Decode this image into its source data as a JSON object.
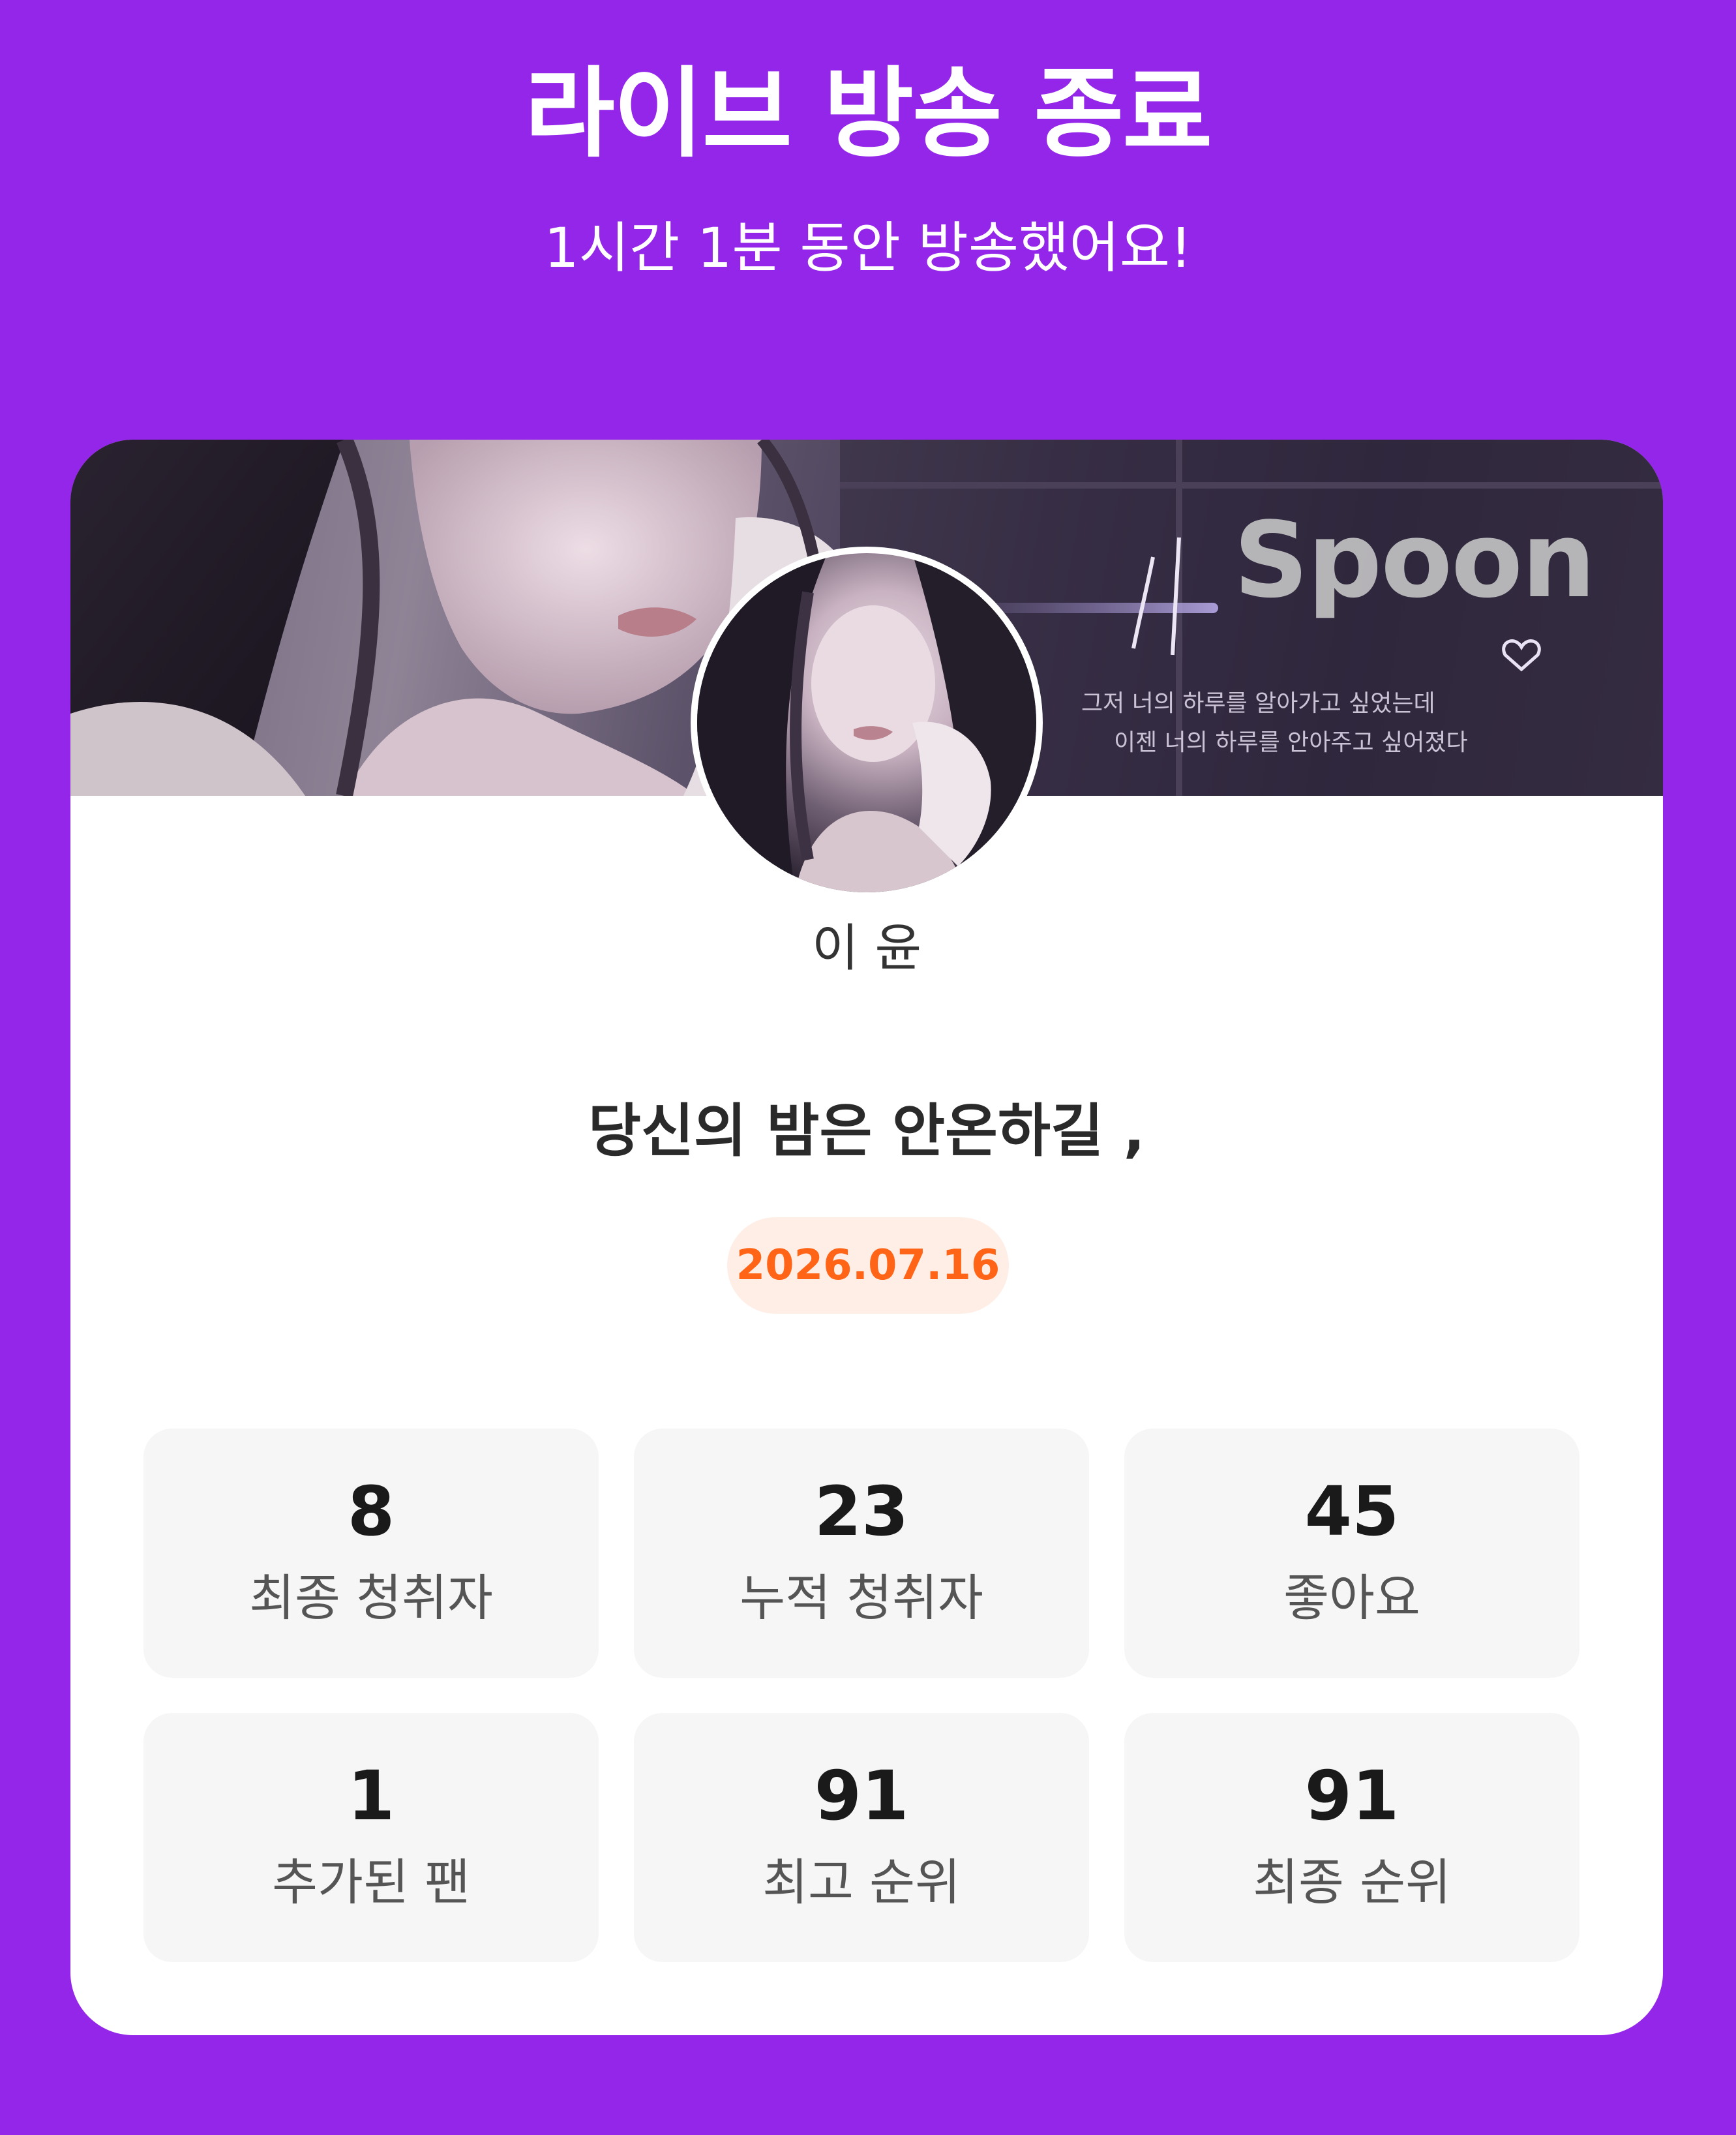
{
  "header": {
    "title": "라이브 방송 종료",
    "subtitle": "1시간 1분 동안 방송했어요!"
  },
  "banner": {
    "watermark": "Spoon",
    "line1": "그저 너의 하루를 알아가고 싶었는데",
    "line2": "이젠 너의 하루를 안아주고 싶어졌다"
  },
  "streamer": {
    "name": "이 윤"
  },
  "broadcast": {
    "title": "당신의 밤은 안온하길 ,",
    "date": "2026.07.16"
  },
  "stats": [
    {
      "value": "8",
      "label": "최종 청취자"
    },
    {
      "value": "23",
      "label": "누적 청취자"
    },
    {
      "value": "45",
      "label": "좋아요"
    },
    {
      "value": "1",
      "label": "추가된 팬"
    },
    {
      "value": "91",
      "label": "최고 순위"
    },
    {
      "value": "91",
      "label": "최종 순위"
    }
  ],
  "colors": {
    "background": "#9326E9",
    "card": "#FFFFFF",
    "date_badge_bg": "#FFEEE6",
    "date_badge_text": "#FF6417",
    "stat_card_bg": "#F6F6F6"
  }
}
